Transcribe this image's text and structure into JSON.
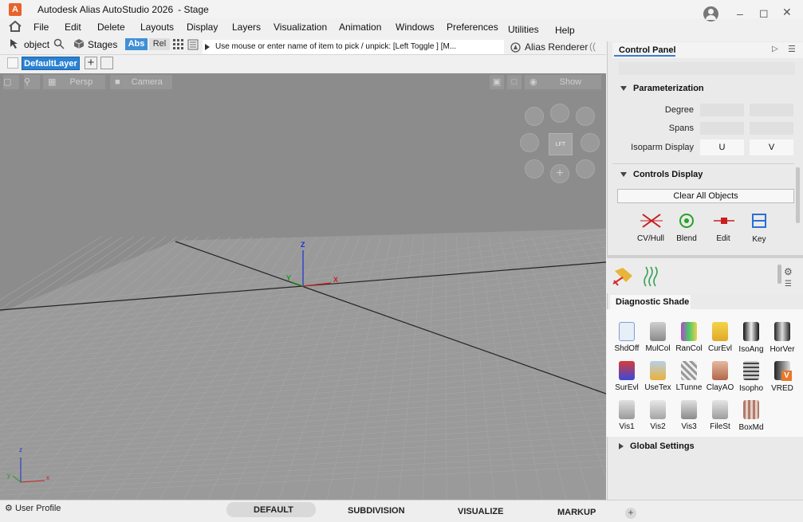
{
  "titlebar": {
    "app_icon": "A",
    "title": "Autodesk Alias AutoStudio 2026",
    "subtitle": "- Stage"
  },
  "menu": [
    "File",
    "Edit",
    "Delete",
    "Layouts",
    "Display",
    "Layers",
    "Visualization",
    "Animation",
    "Windows",
    "Preferences",
    "Utilities",
    "Help"
  ],
  "toolbar": {
    "pick_mode": "object",
    "stages": "Stages",
    "abs": "Abs",
    "rel": "Rel",
    "prompt": "Use mouse or enter name of item to pick / unpick: [Left Toggle ] [M...",
    "renderer": "Alias Renderer"
  },
  "layers": {
    "default_layer": "DefaultLayer",
    "add": "+"
  },
  "viewport": {
    "view_name": "Persp",
    "camera": "Camera",
    "show": "Show",
    "axis_z": "Z",
    "axis_y": "Y",
    "axis_x": "X",
    "mini_z": "z",
    "mini_y": "y",
    "mini_x": "x",
    "viewcube_label": "LFT"
  },
  "control_panel": {
    "title": "Control Panel",
    "parameterization": "Parameterization",
    "degree": "Degree",
    "spans": "Spans",
    "isoparm_display": "Isoparm Display",
    "u": "U",
    "v": "V",
    "controls_display": "Controls Display",
    "clear_all": "Clear All Objects",
    "controls": [
      "CV/Hull",
      "Blend",
      "Edit",
      "Key"
    ],
    "diagnostic_shade": "Diagnostic Shade",
    "shades": [
      "ShdOff",
      "MulCol",
      "RanCol",
      "CurEvl",
      "IsoAng",
      "HorVer",
      "SurEvl",
      "UseTex",
      "LTunne",
      "ClayAO",
      "Isopho",
      "VRED",
      "Vis1",
      "Vis2",
      "Vis3",
      "FileSt",
      "BoxMd"
    ],
    "global_settings": "Global Settings"
  },
  "statusbar": {
    "user_profile": "User Profile",
    "modes": [
      "DEFAULT",
      "SUBDIVISION",
      "VISUALIZE",
      "MARKUP"
    ],
    "add": "+"
  }
}
